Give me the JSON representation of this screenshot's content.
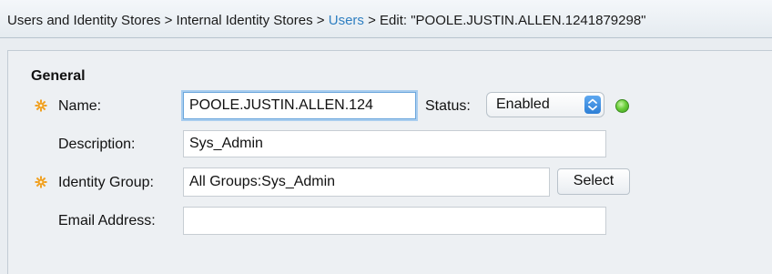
{
  "breadcrumb": {
    "items": [
      {
        "label": "Users and Identity Stores"
      },
      {
        "label": "Internal Identity Stores"
      },
      {
        "label": "Users"
      },
      {
        "label": "Edit: \"POOLE.JUSTIN.ALLEN.1241879298\""
      }
    ],
    "separator": ">"
  },
  "section": {
    "title": "General"
  },
  "form": {
    "name": {
      "label": "Name:",
      "value": "POOLE.JUSTIN.ALLEN.124",
      "required": true
    },
    "status": {
      "label": "Status:",
      "value": "Enabled",
      "indicator_color": "#5cc43a"
    },
    "description": {
      "label": "Description:",
      "value": "Sys_Admin"
    },
    "identity_group": {
      "label": "Identity Group:",
      "value": "All Groups:Sys_Admin",
      "required": true,
      "button_label": "Select"
    },
    "email": {
      "label": "Email Address:",
      "value": ""
    }
  },
  "colors": {
    "link": "#2f7fc1",
    "required_icon": "#f0a020",
    "focus_ring": "#a9cdef",
    "select_arrow": "#3b8fe3"
  },
  "icons": {
    "required": "gear-asterisk-icon",
    "select_arrow": "chevron-up-down-icon",
    "status": "status-led-icon"
  }
}
